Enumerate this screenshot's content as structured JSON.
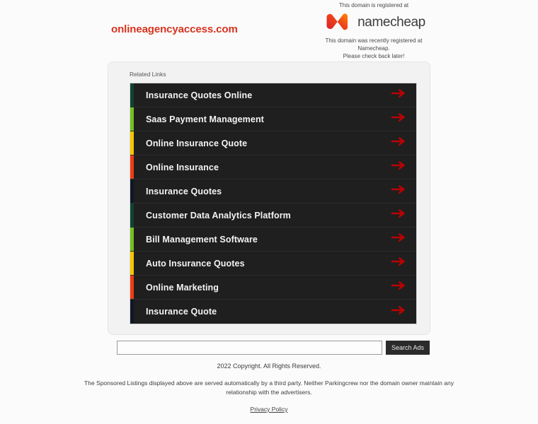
{
  "header": {
    "domain": "onlineagencyaccess.com",
    "registered_at_text": "This domain is registered at",
    "brand": "namecheap",
    "note_line1": "This domain was recently registered at Namecheap.",
    "note_line2": "Please check back later!"
  },
  "card": {
    "related_links_label": "Related Links",
    "links": [
      {
        "label": "Insurance Quotes Online",
        "accent": "#0e4430"
      },
      {
        "label": "Saas Payment Management",
        "accent": "#72bf24"
      },
      {
        "label": "Online Insurance Quote",
        "accent": "#f5c400"
      },
      {
        "label": "Online Insurance",
        "accent": "#f03c12"
      },
      {
        "label": "Insurance Quotes",
        "accent": "#101828"
      },
      {
        "label": "Customer Data Analytics Platform",
        "accent": "#0e4430"
      },
      {
        "label": "Bill Management Software",
        "accent": "#72bf24"
      },
      {
        "label": "Auto Insurance Quotes",
        "accent": "#f5c400"
      },
      {
        "label": "Online Marketing",
        "accent": "#f03c12"
      },
      {
        "label": "Insurance Quote",
        "accent": "#101828"
      }
    ],
    "arrow_color": "#c20000"
  },
  "search": {
    "value": "",
    "placeholder": "",
    "button_label": "Search Ads"
  },
  "footer": {
    "copyright": "2022 Copyright. All Rights Reserved.",
    "disclaimer": "The Sponsored Listings displayed above are served automatically by a third party. Neither Parkingcrew nor the domain owner maintain any relationship with the advertisers.",
    "privacy_policy": "Privacy Policy"
  },
  "colors": {
    "brand_red": "#d9321e",
    "list_bg": "#1f1f1f",
    "page_bg": "#fbfbfb"
  }
}
